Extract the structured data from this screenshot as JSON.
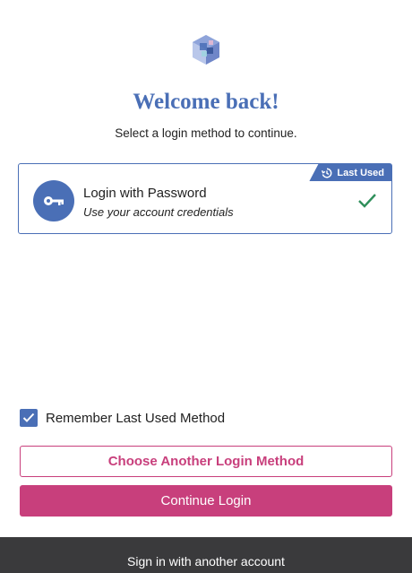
{
  "header": {
    "title": "Welcome back!",
    "subtitle": "Select a login method to continue."
  },
  "login_method": {
    "title": "Login with Password",
    "description": "Use your account credentials",
    "badge": "Last Used",
    "selected": true,
    "icon": "key-icon"
  },
  "remember": {
    "label": "Remember Last Used Method",
    "checked": true
  },
  "buttons": {
    "choose_another": "Choose Another Login Method",
    "continue": "Continue Login"
  },
  "footer": {
    "link": "Sign in with another account"
  },
  "colors": {
    "accent_blue": "#4a6fb6",
    "accent_pink": "#c83f7c",
    "check_green": "#2f8f5b",
    "footer_bg": "#3a3a3c"
  }
}
